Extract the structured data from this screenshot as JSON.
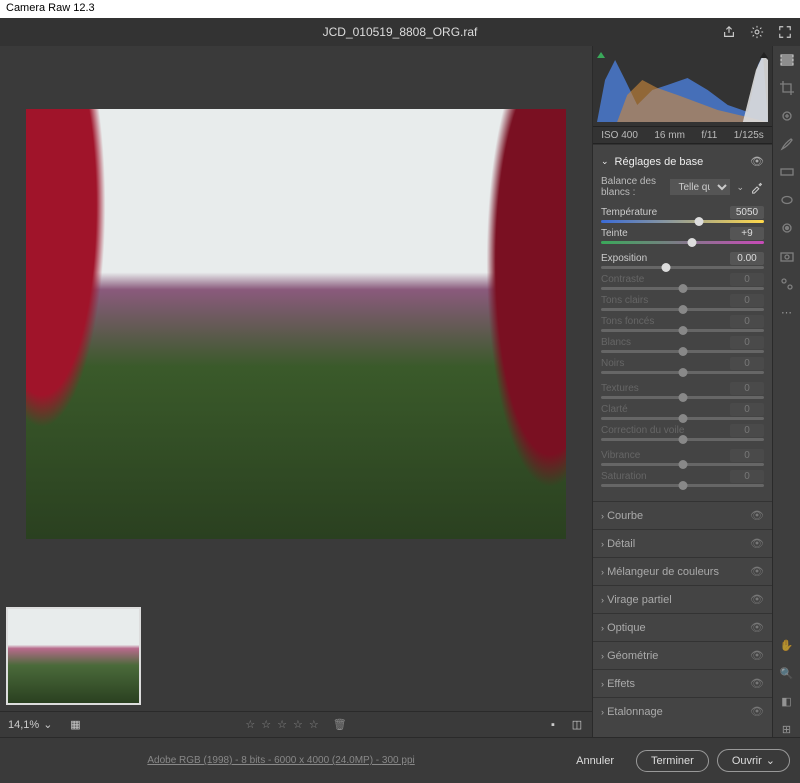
{
  "app": {
    "title": "Camera Raw 12.3"
  },
  "header": {
    "filename": "JCD_010519_8808_ORG.raf"
  },
  "exif": {
    "iso": "ISO 400",
    "focal": "16 mm",
    "aperture": "f/11",
    "shutter": "1/125s"
  },
  "panels": {
    "basic": {
      "title": "Réglages de base",
      "wb_label": "Balance des blancs :",
      "wb_value": "Telle qu…",
      "sliders": {
        "temperature": {
          "label": "Température",
          "value": "5050",
          "pos": 60
        },
        "tint": {
          "label": "Teinte",
          "value": "+9",
          "pos": 56
        },
        "exposure": {
          "label": "Exposition",
          "value": "0.00",
          "pos": 40
        },
        "contrast": {
          "label": "Contraste",
          "value": "0",
          "pos": 50
        },
        "highlights": {
          "label": "Tons clairs",
          "value": "0",
          "pos": 50
        },
        "shadows": {
          "label": "Tons foncés",
          "value": "0",
          "pos": 50
        },
        "whites": {
          "label": "Blancs",
          "value": "0",
          "pos": 50
        },
        "blacks": {
          "label": "Noirs",
          "value": "0",
          "pos": 50
        },
        "texture": {
          "label": "Textures",
          "value": "0",
          "pos": 50
        },
        "clarity": {
          "label": "Clarté",
          "value": "0",
          "pos": 50
        },
        "dehaze": {
          "label": "Correction du voile",
          "value": "0",
          "pos": 50
        },
        "vibrance": {
          "label": "Vibrance",
          "value": "0",
          "pos": 50
        },
        "saturation": {
          "label": "Saturation",
          "value": "0",
          "pos": 50
        }
      }
    },
    "collapsed": [
      {
        "label": "Courbe"
      },
      {
        "label": "Détail"
      },
      {
        "label": "Mélangeur de couleurs"
      },
      {
        "label": "Virage partiel"
      },
      {
        "label": "Optique"
      },
      {
        "label": "Géométrie"
      },
      {
        "label": "Effets"
      },
      {
        "label": "Etalonnage"
      }
    ]
  },
  "footer": {
    "zoom": "14,1%",
    "fileinfo": "Adobe RGB (1998) - 8 bits - 6000 x 4000 (24.0MP) - 300 ppi",
    "cancel": "Annuler",
    "done": "Terminer",
    "open": "Ouvrir"
  },
  "icons": {
    "export": "export-icon",
    "gear": "gear-icon",
    "fullscreen": "fullscreen-icon",
    "eyedropper": "eyedropper-icon",
    "eye": "eye-icon"
  }
}
